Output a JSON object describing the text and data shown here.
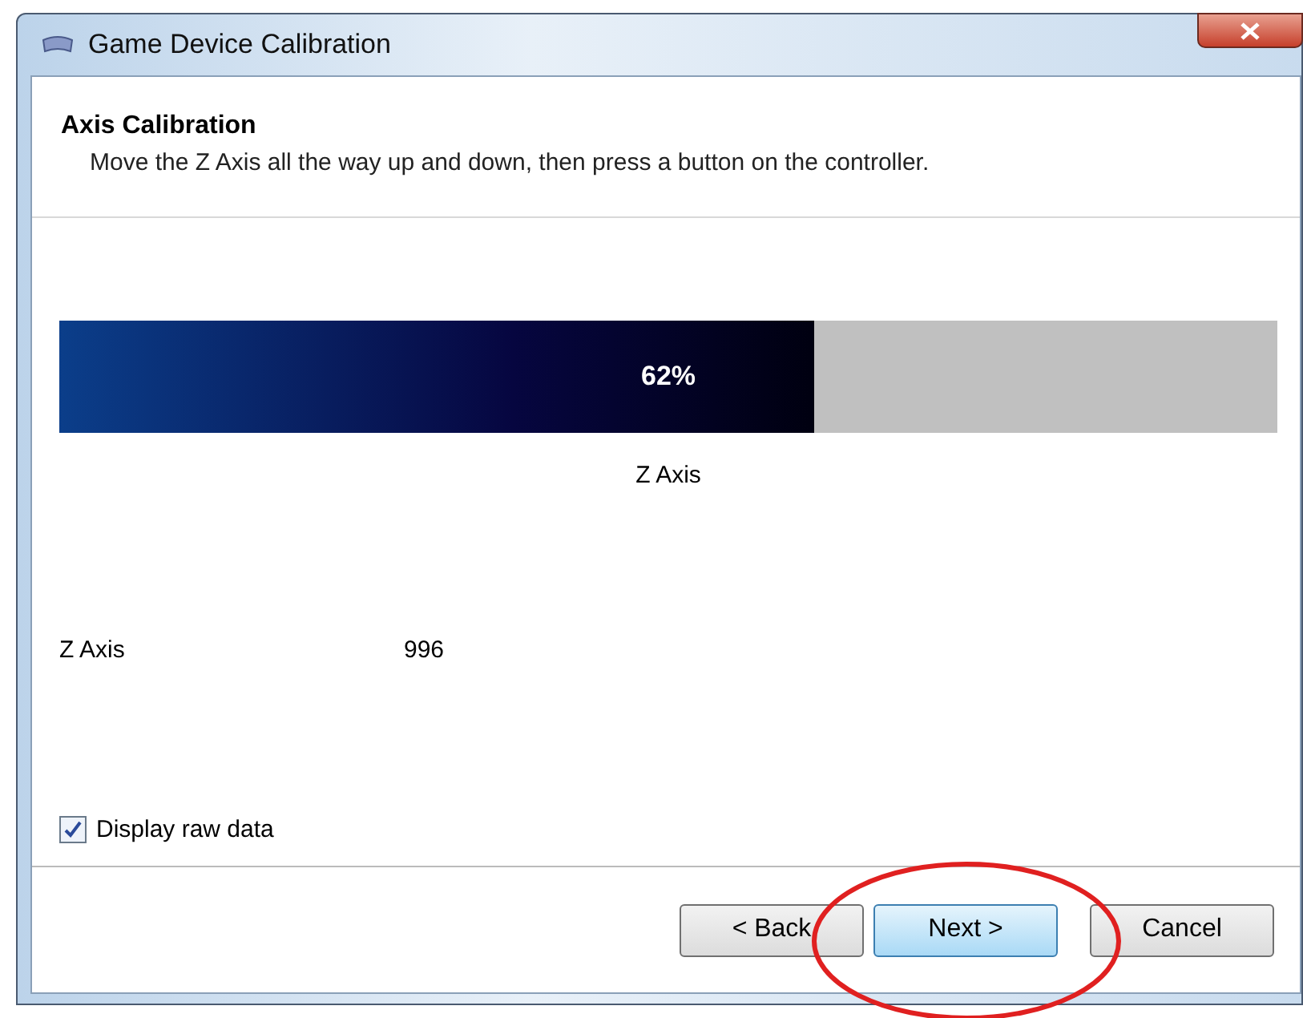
{
  "window": {
    "title": "Game Device Calibration"
  },
  "header": {
    "title": "Axis Calibration",
    "instruction": "Move the Z Axis all the way up and down, then press a button on the controller."
  },
  "progress": {
    "level": 0.62,
    "reading": "62%",
    "label": "Z Axis"
  },
  "raw_data": {
    "name": "Z Axis",
    "value": "996"
  },
  "display_raw": {
    "label": "Display raw data",
    "checked": true
  },
  "buttons": [
    {
      "label": "< Back",
      "focused": false
    },
    {
      "label": "Next >",
      "focused": true
    },
    {
      "label": "Cancel",
      "focused": false
    }
  ]
}
